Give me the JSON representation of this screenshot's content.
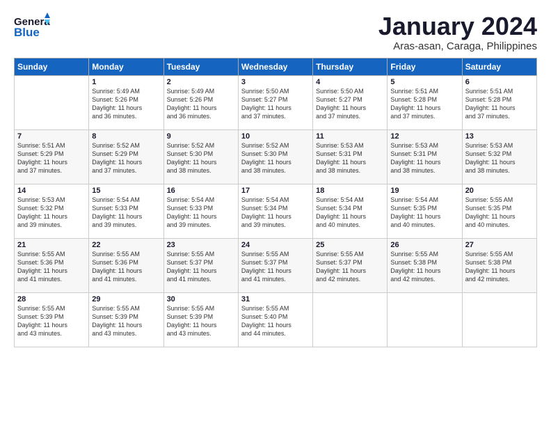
{
  "header": {
    "logo_general": "General",
    "logo_blue": "Blue",
    "title": "January 2024",
    "subtitle": "Aras-asan, Caraga, Philippines"
  },
  "days_of_week": [
    "Sunday",
    "Monday",
    "Tuesday",
    "Wednesday",
    "Thursday",
    "Friday",
    "Saturday"
  ],
  "weeks": [
    [
      {
        "day": "",
        "info": ""
      },
      {
        "day": "1",
        "info": "Sunrise: 5:49 AM\nSunset: 5:26 PM\nDaylight: 11 hours\nand 36 minutes."
      },
      {
        "day": "2",
        "info": "Sunrise: 5:49 AM\nSunset: 5:26 PM\nDaylight: 11 hours\nand 36 minutes."
      },
      {
        "day": "3",
        "info": "Sunrise: 5:50 AM\nSunset: 5:27 PM\nDaylight: 11 hours\nand 37 minutes."
      },
      {
        "day": "4",
        "info": "Sunrise: 5:50 AM\nSunset: 5:27 PM\nDaylight: 11 hours\nand 37 minutes."
      },
      {
        "day": "5",
        "info": "Sunrise: 5:51 AM\nSunset: 5:28 PM\nDaylight: 11 hours\nand 37 minutes."
      },
      {
        "day": "6",
        "info": "Sunrise: 5:51 AM\nSunset: 5:28 PM\nDaylight: 11 hours\nand 37 minutes."
      }
    ],
    [
      {
        "day": "7",
        "info": "Sunrise: 5:51 AM\nSunset: 5:29 PM\nDaylight: 11 hours\nand 37 minutes."
      },
      {
        "day": "8",
        "info": "Sunrise: 5:52 AM\nSunset: 5:29 PM\nDaylight: 11 hours\nand 37 minutes."
      },
      {
        "day": "9",
        "info": "Sunrise: 5:52 AM\nSunset: 5:30 PM\nDaylight: 11 hours\nand 38 minutes."
      },
      {
        "day": "10",
        "info": "Sunrise: 5:52 AM\nSunset: 5:30 PM\nDaylight: 11 hours\nand 38 minutes."
      },
      {
        "day": "11",
        "info": "Sunrise: 5:53 AM\nSunset: 5:31 PM\nDaylight: 11 hours\nand 38 minutes."
      },
      {
        "day": "12",
        "info": "Sunrise: 5:53 AM\nSunset: 5:31 PM\nDaylight: 11 hours\nand 38 minutes."
      },
      {
        "day": "13",
        "info": "Sunrise: 5:53 AM\nSunset: 5:32 PM\nDaylight: 11 hours\nand 38 minutes."
      }
    ],
    [
      {
        "day": "14",
        "info": "Sunrise: 5:53 AM\nSunset: 5:32 PM\nDaylight: 11 hours\nand 39 minutes."
      },
      {
        "day": "15",
        "info": "Sunrise: 5:54 AM\nSunset: 5:33 PM\nDaylight: 11 hours\nand 39 minutes."
      },
      {
        "day": "16",
        "info": "Sunrise: 5:54 AM\nSunset: 5:33 PM\nDaylight: 11 hours\nand 39 minutes."
      },
      {
        "day": "17",
        "info": "Sunrise: 5:54 AM\nSunset: 5:34 PM\nDaylight: 11 hours\nand 39 minutes."
      },
      {
        "day": "18",
        "info": "Sunrise: 5:54 AM\nSunset: 5:34 PM\nDaylight: 11 hours\nand 40 minutes."
      },
      {
        "day": "19",
        "info": "Sunrise: 5:54 AM\nSunset: 5:35 PM\nDaylight: 11 hours\nand 40 minutes."
      },
      {
        "day": "20",
        "info": "Sunrise: 5:55 AM\nSunset: 5:35 PM\nDaylight: 11 hours\nand 40 minutes."
      }
    ],
    [
      {
        "day": "21",
        "info": "Sunrise: 5:55 AM\nSunset: 5:36 PM\nDaylight: 11 hours\nand 41 minutes."
      },
      {
        "day": "22",
        "info": "Sunrise: 5:55 AM\nSunset: 5:36 PM\nDaylight: 11 hours\nand 41 minutes."
      },
      {
        "day": "23",
        "info": "Sunrise: 5:55 AM\nSunset: 5:37 PM\nDaylight: 11 hours\nand 41 minutes."
      },
      {
        "day": "24",
        "info": "Sunrise: 5:55 AM\nSunset: 5:37 PM\nDaylight: 11 hours\nand 41 minutes."
      },
      {
        "day": "25",
        "info": "Sunrise: 5:55 AM\nSunset: 5:37 PM\nDaylight: 11 hours\nand 42 minutes."
      },
      {
        "day": "26",
        "info": "Sunrise: 5:55 AM\nSunset: 5:38 PM\nDaylight: 11 hours\nand 42 minutes."
      },
      {
        "day": "27",
        "info": "Sunrise: 5:55 AM\nSunset: 5:38 PM\nDaylight: 11 hours\nand 42 minutes."
      }
    ],
    [
      {
        "day": "28",
        "info": "Sunrise: 5:55 AM\nSunset: 5:39 PM\nDaylight: 11 hours\nand 43 minutes."
      },
      {
        "day": "29",
        "info": "Sunrise: 5:55 AM\nSunset: 5:39 PM\nDaylight: 11 hours\nand 43 minutes."
      },
      {
        "day": "30",
        "info": "Sunrise: 5:55 AM\nSunset: 5:39 PM\nDaylight: 11 hours\nand 43 minutes."
      },
      {
        "day": "31",
        "info": "Sunrise: 5:55 AM\nSunset: 5:40 PM\nDaylight: 11 hours\nand 44 minutes."
      },
      {
        "day": "",
        "info": ""
      },
      {
        "day": "",
        "info": ""
      },
      {
        "day": "",
        "info": ""
      }
    ]
  ]
}
